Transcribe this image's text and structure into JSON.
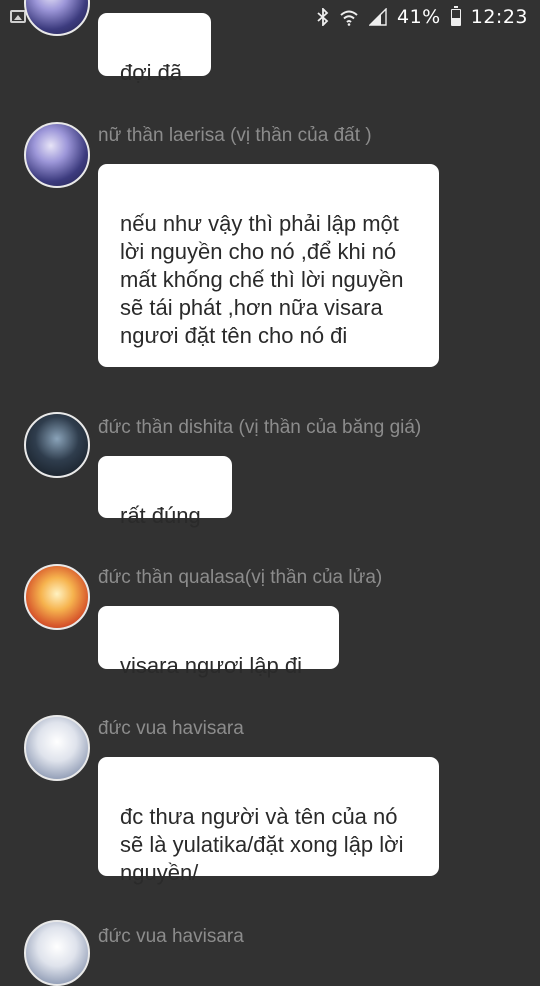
{
  "status_bar": {
    "battery": "41%",
    "time": "12:23",
    "battery_level": 0.41,
    "icons": [
      "gallery-icon",
      "bluetooth-icon",
      "wifi-icon",
      "signal-icon",
      "battery-icon"
    ]
  },
  "messages": [
    {
      "sender": "",
      "text": "đợi đã"
    },
    {
      "sender": "nữ thần laerisa (vị thần của đất )",
      "text": "nếu như vậy thì phải lập một lời nguyền cho nó ,để khi nó mất khống chế thì lời nguyền sẽ tái phát ,hơn nữa visara ngươi đặt tên cho nó đi"
    },
    {
      "sender": "đức thần dishita (vị thần của băng giá)",
      "text": "rất đúng"
    },
    {
      "sender": "đức thần qualasa(vị thần của lửa)",
      "text": "visara ngươi lập đi"
    },
    {
      "sender": "đức vua havisara",
      "text": "đc thưa người và tên của nó sẽ là yulatika/đặt xong lập lời nguyền/"
    },
    {
      "sender": "đức vua havisara",
      "text": ""
    }
  ]
}
